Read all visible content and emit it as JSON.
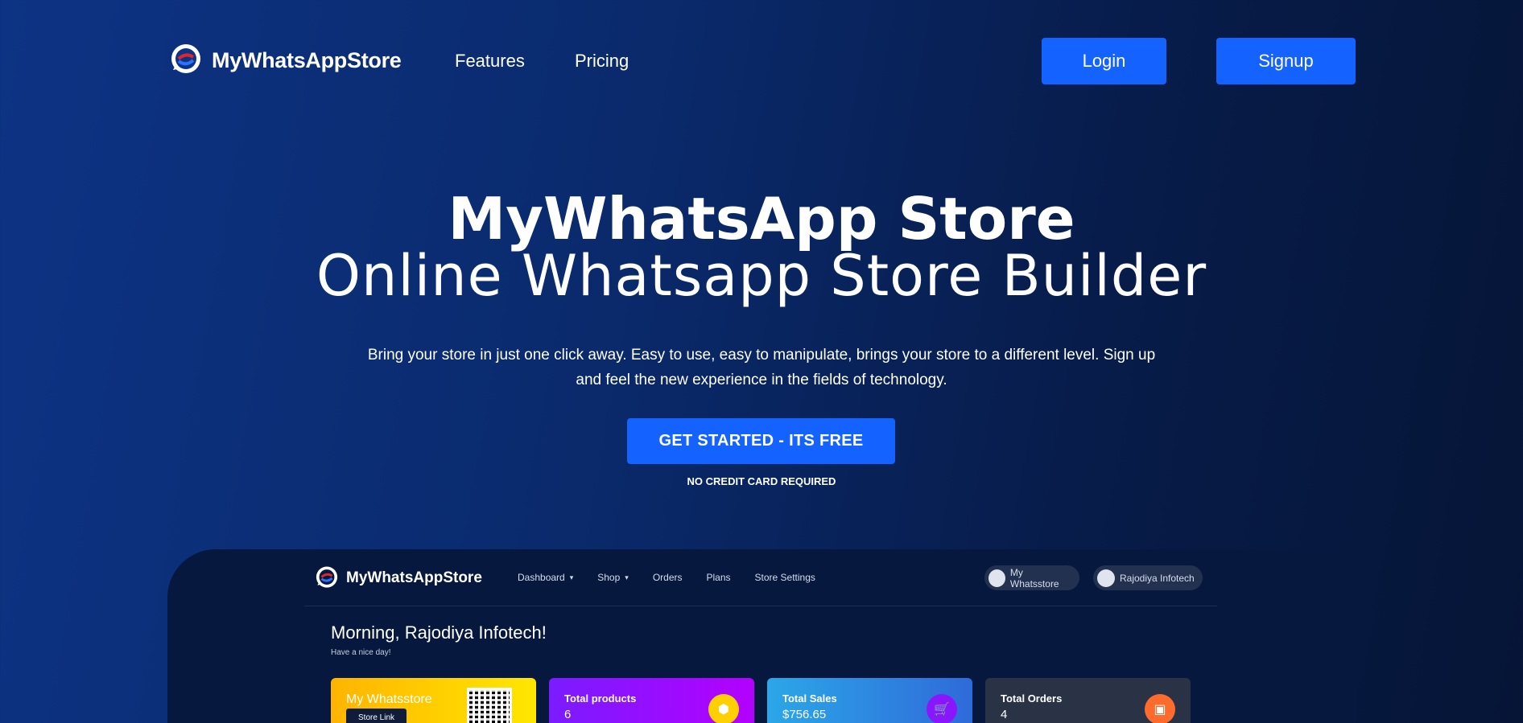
{
  "nav": {
    "brand": "MyWhatsAppStore",
    "links": [
      "Features",
      "Pricing"
    ],
    "login": "Login",
    "signup": "Signup"
  },
  "hero": {
    "title": "MyWhatsApp Store",
    "subtitle": "Online Whatsapp Store Builder",
    "description": "Bring your store in just one click away. Easy to use, easy to manipulate, brings your store to a different level. Sign up and feel the new experience in the fields of technology.",
    "cta": "GET STARTED - ITS FREE",
    "cta_note": "NO CREDIT CARD REQUIRED"
  },
  "preview": {
    "brand": "MyWhatsAppStore",
    "menu": [
      "Dashboard",
      "Shop",
      "Orders",
      "Plans",
      "Store Settings"
    ],
    "store_pill": "My Whatsstore",
    "user_pill": "Rajodiya Infotech",
    "greeting": "Morning, Rajodiya Infotech!",
    "subgreeting": "Have a nice day!",
    "cards": [
      {
        "title": "My Whatsstore",
        "action": "Store Link"
      },
      {
        "title": "Total products",
        "value": "6",
        "icon": "box-icon"
      },
      {
        "title": "Total Sales",
        "value": "$756.65",
        "icon": "cart-icon"
      },
      {
        "title": "Total Orders",
        "value": "4",
        "icon": "bag-icon"
      }
    ]
  },
  "colors": {
    "accent": "#1462ff",
    "background_start": "#0d3384",
    "background_end": "#061536"
  }
}
